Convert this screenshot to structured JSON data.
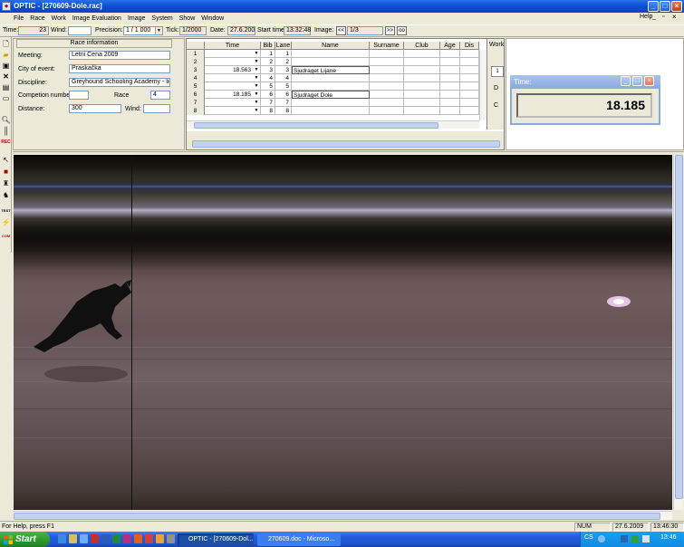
{
  "window": {
    "title": "OPTIC - [270609-Dole.rac]",
    "icon": "app-icon"
  },
  "menu": {
    "items": [
      "File",
      "Race",
      "Work",
      "Image Evaluation",
      "Image",
      "System",
      "Show",
      "Window"
    ],
    "help": "Help"
  },
  "toolbar": {
    "time_label": "Time:",
    "time_value": "23",
    "wind_label": "Wind:",
    "wind_value": "",
    "precision_label": "Precision:",
    "precision_value": "1 / 1 000",
    "tick_label": "Tick:",
    "tick_value": "1/2000",
    "date_label": "Date:",
    "date_value": "27.6.200",
    "start_time_label": "Start time",
    "start_time_value": "13:32:48",
    "image_label": "Image:",
    "image_prev": "<<",
    "image_value": "1/3",
    "image_next": ">>",
    "image_zoom": "oo"
  },
  "left_toolbar": [
    "new-icon",
    "open-icon",
    "save-icon",
    "delete-icon",
    "print-icon",
    "preview-icon",
    "search-icon",
    "barcode-icon",
    "record-icon",
    "pointer-icon",
    "stop-icon",
    "marker-icon",
    "runner-icon",
    "test-icon",
    "lightning-icon",
    "com-icon"
  ],
  "left_toolbar_text": {
    "record": "REC",
    "test": "TEST",
    "com": "COM"
  },
  "race_info": {
    "header": "Race information",
    "meeting_label": "Meeting:",
    "meeting_value": "Letni Cena 2009",
    "city_label": "City of event:",
    "city_value": "Praskačka",
    "discipline_label": "Discipline:",
    "discipline_value": "Greyhound Schooling Academy - licen",
    "competition_label": "Competion number:",
    "competition_value": "",
    "race_label": "Race",
    "race_value": "4",
    "distance_label": "Distance:",
    "distance_value": "300",
    "wind_label": "Wind:",
    "wind_value": ""
  },
  "grid": {
    "columns": [
      "Time",
      "Bib",
      "Lane",
      "Name",
      "Surname",
      "Club",
      "Age",
      "Dis"
    ],
    "rows": [
      {
        "n": "1",
        "time": "",
        "bib": "1",
        "lane": "1",
        "name": ""
      },
      {
        "n": "2",
        "time": "",
        "bib": "2",
        "lane": "2",
        "name": ""
      },
      {
        "n": "3",
        "time": "18.563",
        "bib": "3",
        "lane": "3",
        "name": "Sjudraget Lijane"
      },
      {
        "n": "4",
        "time": "",
        "bib": "4",
        "lane": "4",
        "name": ""
      },
      {
        "n": "5",
        "time": "",
        "bib": "5",
        "lane": "5",
        "name": ""
      },
      {
        "n": "6",
        "time": "18.185",
        "bib": "6",
        "lane": "6",
        "name": "Sjudraget Dole"
      },
      {
        "n": "7",
        "time": "",
        "bib": "7",
        "lane": "7",
        "name": ""
      },
      {
        "n": "8",
        "time": "",
        "bib": "8",
        "lane": "8",
        "name": ""
      }
    ],
    "work_label": "Work",
    "work_items": [
      "1",
      "D",
      "C"
    ]
  },
  "time_window": {
    "title": "Time:",
    "value": "18.185"
  },
  "status": {
    "help_text": "For Help, press F1",
    "num": "NUM",
    "date": "27.6.2009",
    "time": "13:46:30"
  },
  "taskbar": {
    "start": "Start",
    "items": [
      "OPTIC - [270609-Dol...",
      "270609.doc - Microso..."
    ],
    "lang": "CS",
    "clock": "13:46"
  },
  "colors": {
    "titlebar": "#0b4fd4",
    "taskbar": "#245edb",
    "start": "#2f9e2f",
    "window_bg": "#ece9d8"
  }
}
